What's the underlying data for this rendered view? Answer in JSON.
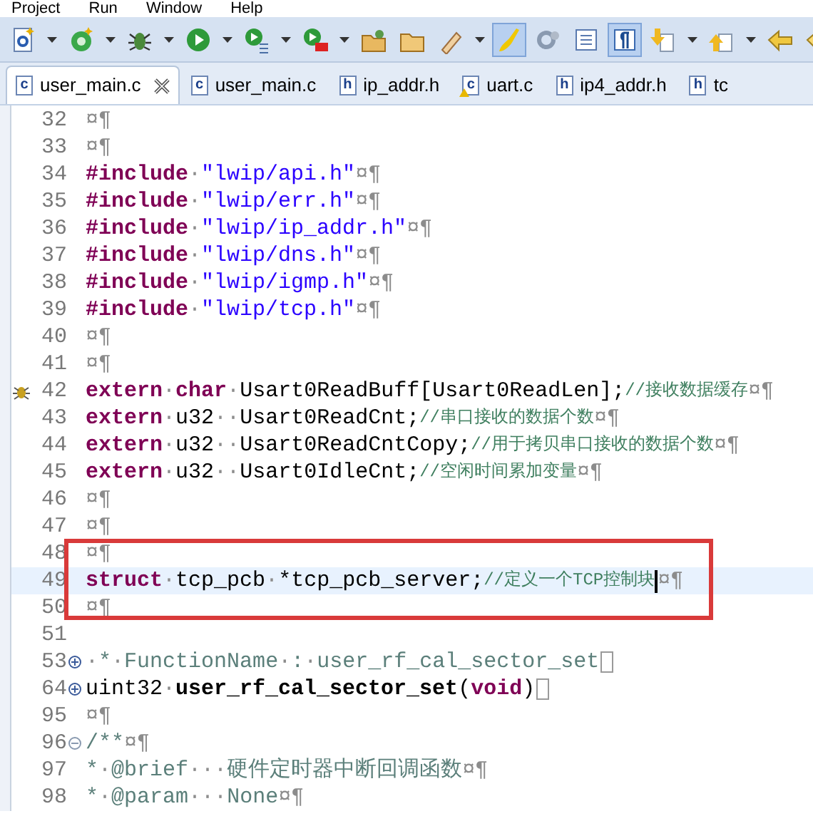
{
  "menu": [
    "Project",
    "Run",
    "Window",
    "Help"
  ],
  "toolbar": [
    {
      "kind": "new-c",
      "dropdown": true,
      "pressed": false
    },
    {
      "kind": "new-class",
      "dropdown": true,
      "pressed": false
    },
    {
      "kind": "debug",
      "dropdown": true,
      "pressed": false
    },
    {
      "kind": "run",
      "dropdown": true,
      "pressed": false
    },
    {
      "kind": "run-config",
      "dropdown": true,
      "pressed": false
    },
    {
      "kind": "stop",
      "dropdown": true,
      "pressed": false
    },
    {
      "kind": "open-folder",
      "dropdown": false,
      "pressed": false
    },
    {
      "kind": "folder",
      "dropdown": false,
      "pressed": false
    },
    {
      "kind": "pen",
      "dropdown": true,
      "pressed": false
    },
    {
      "kind": "brush",
      "dropdown": false,
      "pressed": true
    },
    {
      "kind": "gear",
      "dropdown": false,
      "pressed": false
    },
    {
      "kind": "columns",
      "dropdown": false,
      "pressed": false
    },
    {
      "kind": "pilcrow",
      "dropdown": false,
      "pressed": true
    },
    {
      "kind": "down-arrow",
      "dropdown": true,
      "pressed": false
    },
    {
      "kind": "up-arrow",
      "dropdown": true,
      "pressed": false
    },
    {
      "kind": "back",
      "dropdown": false,
      "pressed": false
    },
    {
      "kind": "left-arrow",
      "dropdown": false,
      "pressed": false
    }
  ],
  "tabs": [
    {
      "label": "user_main.c",
      "type": "c",
      "selected": true,
      "closable": true,
      "warning": false
    },
    {
      "label": "user_main.c",
      "type": "c",
      "selected": false,
      "closable": false,
      "warning": false
    },
    {
      "label": "ip_addr.h",
      "type": "h",
      "selected": false,
      "closable": false,
      "warning": false
    },
    {
      "label": "uart.c",
      "type": "c",
      "selected": false,
      "closable": false,
      "warning": true
    },
    {
      "label": "ip4_addr.h",
      "type": "h",
      "selected": false,
      "closable": false,
      "warning": false
    },
    {
      "label": "tc",
      "type": "h",
      "selected": false,
      "closable": false,
      "warning": false
    }
  ],
  "editor": {
    "lines": [
      {
        "number": "32",
        "segments": [
          {
            "kind": "ws",
            "text": "¤¶"
          }
        ]
      },
      {
        "number": "33",
        "segments": [
          {
            "kind": "ws",
            "text": "¤¶"
          }
        ]
      },
      {
        "number": "34",
        "segments": [
          {
            "kind": "kw",
            "text": "#include"
          },
          {
            "kind": "ws",
            "text": "·"
          },
          {
            "kind": "str",
            "text": "\"lwip/api.h\""
          },
          {
            "kind": "ws",
            "text": "¤¶"
          }
        ]
      },
      {
        "number": "35",
        "segments": [
          {
            "kind": "kw",
            "text": "#include"
          },
          {
            "kind": "ws",
            "text": "·"
          },
          {
            "kind": "str",
            "text": "\"lwip/err.h\""
          },
          {
            "kind": "ws",
            "text": "¤¶"
          }
        ]
      },
      {
        "number": "36",
        "segments": [
          {
            "kind": "kw",
            "text": "#include"
          },
          {
            "kind": "ws",
            "text": "·"
          },
          {
            "kind": "str",
            "text": "\"lwip/ip_addr.h\""
          },
          {
            "kind": "ws",
            "text": "¤¶"
          }
        ]
      },
      {
        "number": "37",
        "segments": [
          {
            "kind": "kw",
            "text": "#include"
          },
          {
            "kind": "ws",
            "text": "·"
          },
          {
            "kind": "str",
            "text": "\"lwip/dns.h\""
          },
          {
            "kind": "ws",
            "text": "¤¶"
          }
        ]
      },
      {
        "number": "38",
        "segments": [
          {
            "kind": "kw",
            "text": "#include"
          },
          {
            "kind": "ws",
            "text": "·"
          },
          {
            "kind": "str",
            "text": "\"lwip/igmp.h\""
          },
          {
            "kind": "ws",
            "text": "¤¶"
          }
        ]
      },
      {
        "number": "39",
        "segments": [
          {
            "kind": "kw",
            "text": "#include"
          },
          {
            "kind": "ws",
            "text": "·"
          },
          {
            "kind": "str",
            "text": "\"lwip/tcp.h\""
          },
          {
            "kind": "ws",
            "text": "¤¶"
          }
        ]
      },
      {
        "number": "40",
        "segments": [
          {
            "kind": "ws",
            "text": "¤¶"
          }
        ]
      },
      {
        "number": "41",
        "segments": [
          {
            "kind": "ws",
            "text": "¤¶"
          }
        ]
      },
      {
        "number": "42",
        "breakpoint": true,
        "segments": [
          {
            "kind": "kw",
            "text": "extern"
          },
          {
            "kind": "ws",
            "text": "·"
          },
          {
            "kind": "kw",
            "text": "char"
          },
          {
            "kind": "ws",
            "text": "·"
          },
          {
            "kind": "plain",
            "text": "Usart0ReadBuff[Usart0ReadLen];"
          },
          {
            "kind": "cmt",
            "text": "//接收数据缓存"
          },
          {
            "kind": "ws",
            "text": "¤¶"
          }
        ]
      },
      {
        "number": "43",
        "segments": [
          {
            "kind": "kw",
            "text": "extern"
          },
          {
            "kind": "ws",
            "text": "·"
          },
          {
            "kind": "plain",
            "text": "u32"
          },
          {
            "kind": "ws",
            "text": "··"
          },
          {
            "kind": "plain",
            "text": "Usart0ReadCnt;"
          },
          {
            "kind": "cmt",
            "text": "//串口接收的数据个数"
          },
          {
            "kind": "ws",
            "text": "¤¶"
          }
        ]
      },
      {
        "number": "44",
        "segments": [
          {
            "kind": "kw",
            "text": "extern"
          },
          {
            "kind": "ws",
            "text": "·"
          },
          {
            "kind": "plain",
            "text": "u32"
          },
          {
            "kind": "ws",
            "text": "··"
          },
          {
            "kind": "plain",
            "text": "Usart0ReadCntCopy;"
          },
          {
            "kind": "cmt",
            "text": "//用于拷贝串口接收的数据个数"
          },
          {
            "kind": "ws",
            "text": "¤¶"
          }
        ]
      },
      {
        "number": "45",
        "segments": [
          {
            "kind": "kw",
            "text": "extern"
          },
          {
            "kind": "ws",
            "text": "·"
          },
          {
            "kind": "plain",
            "text": "u32"
          },
          {
            "kind": "ws",
            "text": "··"
          },
          {
            "kind": "plain",
            "text": "Usart0IdleCnt;"
          },
          {
            "kind": "cmt",
            "text": "//空闲时间累加变量"
          },
          {
            "kind": "ws",
            "text": "¤¶"
          }
        ]
      },
      {
        "number": "46",
        "segments": [
          {
            "kind": "ws",
            "text": "¤¶"
          }
        ]
      },
      {
        "number": "47",
        "segments": [
          {
            "kind": "ws",
            "text": "¤¶"
          }
        ]
      },
      {
        "number": "48",
        "boxed": true,
        "segments": [
          {
            "kind": "ws",
            "text": "¤¶"
          }
        ]
      },
      {
        "number": "49",
        "boxed": true,
        "current": true,
        "cursor": true,
        "segments": [
          {
            "kind": "kw",
            "text": "struct"
          },
          {
            "kind": "ws",
            "text": "·"
          },
          {
            "kind": "plain",
            "text": "tcp_pcb"
          },
          {
            "kind": "ws",
            "text": "·"
          },
          {
            "kind": "plain",
            "text": "*tcp_pcb_server;"
          },
          {
            "kind": "cmt",
            "text": "//定义一个TCP控制块"
          },
          {
            "kind": "ws",
            "text": "¤¶"
          }
        ]
      },
      {
        "number": "50",
        "boxed": true,
        "segments": [
          {
            "kind": "ws",
            "text": "¤¶"
          }
        ]
      },
      {
        "number": "51"
      },
      {
        "number": "53",
        "expanded": false,
        "folded": true,
        "segments": [
          {
            "kind": "ws",
            "text": "·"
          },
          {
            "kind": "doc",
            "text": "*"
          },
          {
            "kind": "ws",
            "text": "·"
          },
          {
            "kind": "doc",
            "text": "FunctionName"
          },
          {
            "kind": "ws",
            "text": "·"
          },
          {
            "kind": "doc",
            "text": ":"
          },
          {
            "kind": "ws",
            "text": "·"
          },
          {
            "kind": "doc",
            "text": "user_rf_cal_sector_set"
          }
        ]
      },
      {
        "number": "64",
        "expanded": false,
        "folded": true,
        "segments": [
          {
            "kind": "plain",
            "text": "uint32"
          },
          {
            "kind": "ws",
            "text": "·"
          },
          {
            "kind": "bold",
            "text": "user_rf_cal_sector_set"
          },
          {
            "kind": "plain",
            "text": "("
          },
          {
            "kind": "kw",
            "text": "void"
          },
          {
            "kind": "plain",
            "text": ")"
          }
        ]
      },
      {
        "number": "95",
        "segments": [
          {
            "kind": "ws",
            "text": "¤¶"
          }
        ]
      },
      {
        "number": "96",
        "expanded": true,
        "segments": [
          {
            "kind": "doc",
            "text": "/**"
          },
          {
            "kind": "ws",
            "text": "¤¶"
          }
        ]
      },
      {
        "number": "97",
        "segments": [
          {
            "kind": "doc",
            "text": "*"
          },
          {
            "kind": "ws",
            "text": "·"
          },
          {
            "kind": "doc",
            "text": "@brief"
          },
          {
            "kind": "ws",
            "text": "···"
          },
          {
            "kind": "doc",
            "text": "硬件定时器中断回调函数"
          },
          {
            "kind": "ws",
            "text": "¤¶"
          }
        ]
      },
      {
        "number": "98",
        "segments": [
          {
            "kind": "doc",
            "text": "*"
          },
          {
            "kind": "ws",
            "text": "·"
          },
          {
            "kind": "doc",
            "text": "@param"
          },
          {
            "kind": "ws",
            "text": "···"
          },
          {
            "kind": "doc",
            "text": "None"
          },
          {
            "kind": "ws",
            "text": "¤¶"
          }
        ]
      }
    ]
  }
}
